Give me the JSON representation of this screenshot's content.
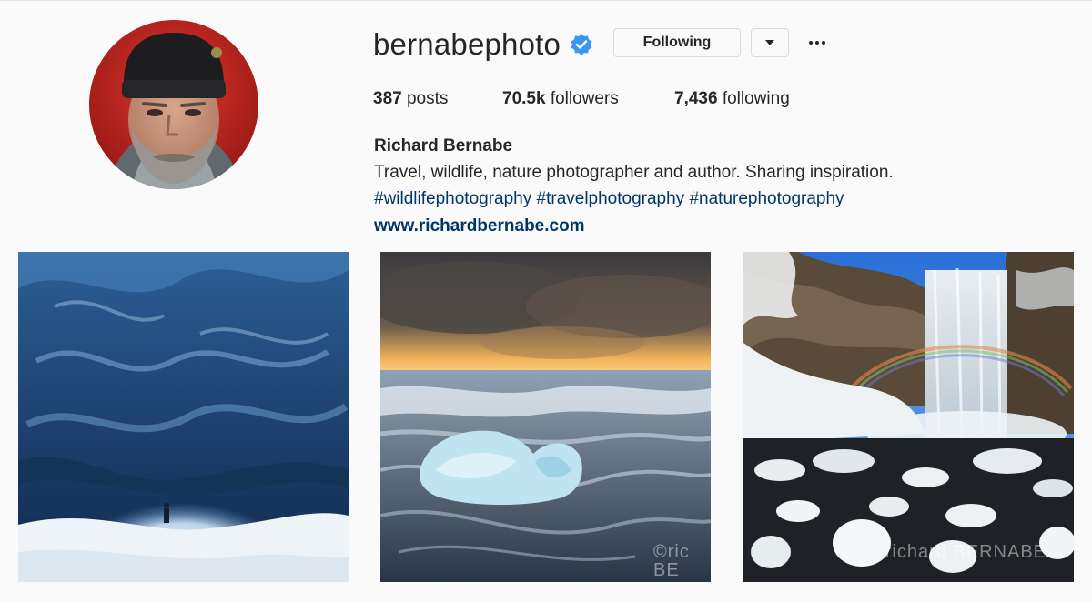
{
  "profile": {
    "username": "bernabephoto",
    "verified": true,
    "follow_button": "Following",
    "full_name": "Richard Bernabe",
    "bio": "Travel, wildlife, nature photographer and author. Sharing inspiration.",
    "hashtags": [
      "#wildlifephotography",
      "#travelphotography",
      "#naturephotography"
    ],
    "website": "www.richardbernabe.com"
  },
  "stats": {
    "posts_count": "387",
    "posts_label": "posts",
    "followers_count": "70.5k",
    "followers_label": "followers",
    "following_count": "7,436",
    "following_label": "following"
  },
  "icons": {
    "verified": "verified-badge-icon",
    "dropdown": "chevron-down-icon",
    "more": "more-options-icon"
  },
  "colors": {
    "verified_blue": "#3897f0",
    "link_blue": "#003569",
    "text": "#262626",
    "border": "#dbdbdb",
    "background": "#fafafa"
  },
  "posts": [
    {
      "subject": "ice cave with person silhouette"
    },
    {
      "subject": "ice chunk on black sand beach at sunset",
      "watermark": "©ric BE"
    },
    {
      "subject": "waterfall with rainbow and snow",
      "watermark": "©richard BERNABE"
    }
  ]
}
